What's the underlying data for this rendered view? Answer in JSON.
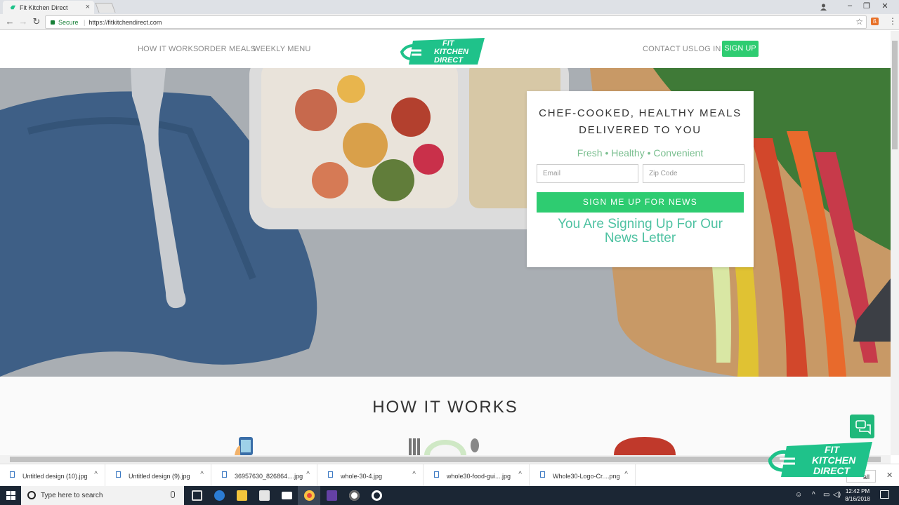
{
  "browser": {
    "tab_title": "Fit Kitchen Direct",
    "tab_close": "×",
    "secure_label": "Secure",
    "url": "https://fitkitchendirect.com"
  },
  "header": {
    "nav_left": [
      "HOW IT WORKS",
      "ORDER MEALS",
      "WEEKLY MENU"
    ],
    "nav_right": [
      "CONTACT US",
      "LOG IN"
    ],
    "signup_label": "SIGN UP",
    "logo_lines": [
      "FIT",
      "KITCHEN",
      "DIRECT"
    ]
  },
  "hero_card": {
    "title_line1": "CHEF-COOKED, HEALTHY MEALS",
    "title_line2": "DELIVERED TO YOU",
    "subtitle": "Fresh • Healthy • Convenient",
    "email_placeholder": "Email",
    "zip_placeholder": "Zip Code",
    "button_label": "SIGN ME UP FOR NEWS",
    "note": "You Are Signing Up For Our News Letter"
  },
  "section": {
    "title": "HOW IT WORKS"
  },
  "downloads": {
    "items": [
      "Untitled design (10).jpg",
      "Untitled design (9).jpg",
      "36957630_826864....jpg",
      "whole-30-4.jpg",
      "whole30-food-gui....jpg",
      "Whole30-Logo-Cr....png"
    ],
    "show_all": "all"
  },
  "taskbar": {
    "search_placeholder": "Type here to search",
    "time": "12:42 PM",
    "date": "8/16/2018"
  },
  "colors": {
    "brand_green": "#2ecc71",
    "logo_teal": "#1fc28a",
    "note_teal": "#4fc2a2"
  }
}
